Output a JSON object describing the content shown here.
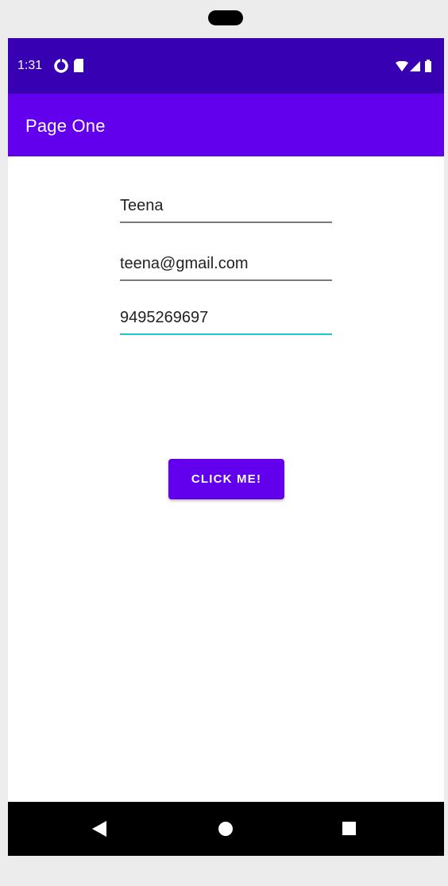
{
  "status_bar": {
    "time": "1:31",
    "icons": [
      "data-saver-icon",
      "sd-card-icon",
      "wifi-icon",
      "signal-icon",
      "battery-icon"
    ],
    "background": "#3700b3"
  },
  "app_bar": {
    "title": "Page One",
    "background": "#6200ee"
  },
  "form": {
    "name_value": "Teena",
    "email_value": "teena@gmail.com",
    "phone_value": "9495269697",
    "focus_color": "#1bc7c0"
  },
  "button": {
    "label": "CLICK ME!",
    "color": "#6200ee"
  },
  "nav_bar": {
    "icons": [
      "back-icon",
      "home-icon",
      "recents-icon"
    ]
  }
}
